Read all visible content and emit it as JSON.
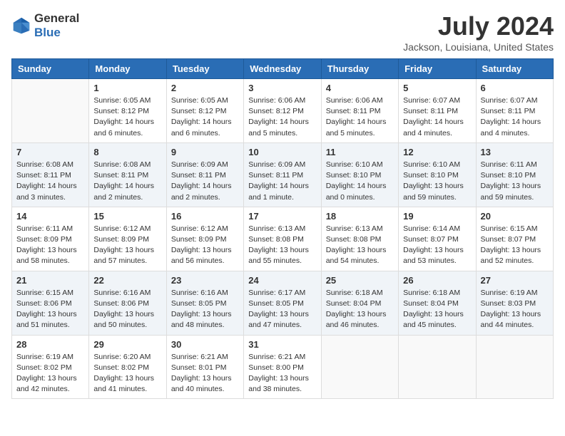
{
  "logo": {
    "text_general": "General",
    "text_blue": "Blue"
  },
  "title": "July 2024",
  "subtitle": "Jackson, Louisiana, United States",
  "days_header": [
    "Sunday",
    "Monday",
    "Tuesday",
    "Wednesday",
    "Thursday",
    "Friday",
    "Saturday"
  ],
  "weeks": [
    [
      {
        "day": "",
        "info": ""
      },
      {
        "day": "1",
        "info": "Sunrise: 6:05 AM\nSunset: 8:12 PM\nDaylight: 14 hours\nand 6 minutes."
      },
      {
        "day": "2",
        "info": "Sunrise: 6:05 AM\nSunset: 8:12 PM\nDaylight: 14 hours\nand 6 minutes."
      },
      {
        "day": "3",
        "info": "Sunrise: 6:06 AM\nSunset: 8:12 PM\nDaylight: 14 hours\nand 5 minutes."
      },
      {
        "day": "4",
        "info": "Sunrise: 6:06 AM\nSunset: 8:11 PM\nDaylight: 14 hours\nand 5 minutes."
      },
      {
        "day": "5",
        "info": "Sunrise: 6:07 AM\nSunset: 8:11 PM\nDaylight: 14 hours\nand 4 minutes."
      },
      {
        "day": "6",
        "info": "Sunrise: 6:07 AM\nSunset: 8:11 PM\nDaylight: 14 hours\nand 4 minutes."
      }
    ],
    [
      {
        "day": "7",
        "info": "Sunrise: 6:08 AM\nSunset: 8:11 PM\nDaylight: 14 hours\nand 3 minutes."
      },
      {
        "day": "8",
        "info": "Sunrise: 6:08 AM\nSunset: 8:11 PM\nDaylight: 14 hours\nand 2 minutes."
      },
      {
        "day": "9",
        "info": "Sunrise: 6:09 AM\nSunset: 8:11 PM\nDaylight: 14 hours\nand 2 minutes."
      },
      {
        "day": "10",
        "info": "Sunrise: 6:09 AM\nSunset: 8:11 PM\nDaylight: 14 hours\nand 1 minute."
      },
      {
        "day": "11",
        "info": "Sunrise: 6:10 AM\nSunset: 8:10 PM\nDaylight: 14 hours\nand 0 minutes."
      },
      {
        "day": "12",
        "info": "Sunrise: 6:10 AM\nSunset: 8:10 PM\nDaylight: 13 hours\nand 59 minutes."
      },
      {
        "day": "13",
        "info": "Sunrise: 6:11 AM\nSunset: 8:10 PM\nDaylight: 13 hours\nand 59 minutes."
      }
    ],
    [
      {
        "day": "14",
        "info": "Sunrise: 6:11 AM\nSunset: 8:09 PM\nDaylight: 13 hours\nand 58 minutes."
      },
      {
        "day": "15",
        "info": "Sunrise: 6:12 AM\nSunset: 8:09 PM\nDaylight: 13 hours\nand 57 minutes."
      },
      {
        "day": "16",
        "info": "Sunrise: 6:12 AM\nSunset: 8:09 PM\nDaylight: 13 hours\nand 56 minutes."
      },
      {
        "day": "17",
        "info": "Sunrise: 6:13 AM\nSunset: 8:08 PM\nDaylight: 13 hours\nand 55 minutes."
      },
      {
        "day": "18",
        "info": "Sunrise: 6:13 AM\nSunset: 8:08 PM\nDaylight: 13 hours\nand 54 minutes."
      },
      {
        "day": "19",
        "info": "Sunrise: 6:14 AM\nSunset: 8:07 PM\nDaylight: 13 hours\nand 53 minutes."
      },
      {
        "day": "20",
        "info": "Sunrise: 6:15 AM\nSunset: 8:07 PM\nDaylight: 13 hours\nand 52 minutes."
      }
    ],
    [
      {
        "day": "21",
        "info": "Sunrise: 6:15 AM\nSunset: 8:06 PM\nDaylight: 13 hours\nand 51 minutes."
      },
      {
        "day": "22",
        "info": "Sunrise: 6:16 AM\nSunset: 8:06 PM\nDaylight: 13 hours\nand 50 minutes."
      },
      {
        "day": "23",
        "info": "Sunrise: 6:16 AM\nSunset: 8:05 PM\nDaylight: 13 hours\nand 48 minutes."
      },
      {
        "day": "24",
        "info": "Sunrise: 6:17 AM\nSunset: 8:05 PM\nDaylight: 13 hours\nand 47 minutes."
      },
      {
        "day": "25",
        "info": "Sunrise: 6:18 AM\nSunset: 8:04 PM\nDaylight: 13 hours\nand 46 minutes."
      },
      {
        "day": "26",
        "info": "Sunrise: 6:18 AM\nSunset: 8:04 PM\nDaylight: 13 hours\nand 45 minutes."
      },
      {
        "day": "27",
        "info": "Sunrise: 6:19 AM\nSunset: 8:03 PM\nDaylight: 13 hours\nand 44 minutes."
      }
    ],
    [
      {
        "day": "28",
        "info": "Sunrise: 6:19 AM\nSunset: 8:02 PM\nDaylight: 13 hours\nand 42 minutes."
      },
      {
        "day": "29",
        "info": "Sunrise: 6:20 AM\nSunset: 8:02 PM\nDaylight: 13 hours\nand 41 minutes."
      },
      {
        "day": "30",
        "info": "Sunrise: 6:21 AM\nSunset: 8:01 PM\nDaylight: 13 hours\nand 40 minutes."
      },
      {
        "day": "31",
        "info": "Sunrise: 6:21 AM\nSunset: 8:00 PM\nDaylight: 13 hours\nand 38 minutes."
      },
      {
        "day": "",
        "info": ""
      },
      {
        "day": "",
        "info": ""
      },
      {
        "day": "",
        "info": ""
      }
    ]
  ]
}
